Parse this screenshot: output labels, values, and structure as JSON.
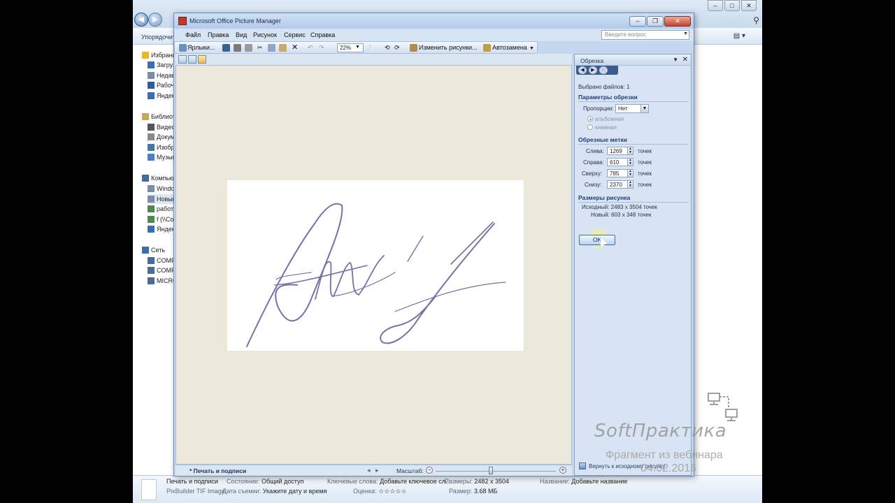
{
  "explorer": {
    "organize_label": "Упорядочить",
    "nav_items": [
      {
        "label": "Избранное",
        "icon": "star-icon"
      },
      {
        "label": "Загрузки",
        "icon": "downloads-icon"
      },
      {
        "label": "Недавние места",
        "icon": "recent-places-icon"
      },
      {
        "label": "Рабочий стол",
        "icon": "desktop-icon"
      },
      {
        "label": "Яндекс.Диск",
        "icon": "cloud-icon"
      },
      {
        "label": "Библиотеки",
        "icon": "library-icon"
      },
      {
        "label": "Видео",
        "icon": "video-icon"
      },
      {
        "label": "Документы",
        "icon": "documents-icon"
      },
      {
        "label": "Изображения",
        "icon": "pictures-icon"
      },
      {
        "label": "Музыка",
        "icon": "music-icon"
      },
      {
        "label": "Компьютер",
        "icon": "computer-icon"
      },
      {
        "label": "Windows",
        "icon": "drive-icon"
      },
      {
        "label": "Новый том",
        "icon": "drive-icon"
      },
      {
        "label": "работа",
        "icon": "network-drive-icon"
      },
      {
        "label": "f (\\\\Co",
        "icon": "network-drive-icon"
      },
      {
        "label": "Яндекс",
        "icon": "cloud-icon"
      },
      {
        "label": "Сеть",
        "icon": "network-icon"
      },
      {
        "label": "COMP",
        "icon": "computer-icon"
      },
      {
        "label": "COMP",
        "icon": "computer-icon"
      },
      {
        "label": "MICRO",
        "icon": "computer-icon"
      }
    ],
    "details": {
      "file_name": "Печать и подписи",
      "file_type": "PixBuilder TIF Image",
      "state_label": "Состояние:",
      "state_value": "Общий доступ",
      "date_label": "Дата съемки:",
      "date_value": "Укажите дату и время",
      "keywords_label": "Ключевые слова:",
      "keywords_value": "Добавьте ключевое сл...",
      "rating_label": "Оценка:",
      "rating_value": "☆☆☆☆☆",
      "dimensions_label": "Размеры:",
      "dimensions_value": "2482 x 3504",
      "size_label": "Размер:",
      "size_value": "3.68 МБ",
      "title_label": "Название:",
      "title_value": "Добавьте название"
    }
  },
  "picture_manager": {
    "title": "Microsoft Office Picture Manager",
    "menu": [
      "Файл",
      "Правка",
      "Вид",
      "Рисунок",
      "Сервис",
      "Справка"
    ],
    "ask_placeholder": "Введите вопрос",
    "toolbar": {
      "shortcuts_label": "Ярлыки...",
      "zoom_value": "22%",
      "edit_pictures_label": "Изменить рисунки...",
      "autocorrect_label": "Автозамена"
    },
    "status": {
      "file_name": "* Печать и подписи",
      "zoom_label": "Масштаб:"
    },
    "zoom_level_fraction": 0.46
  },
  "crop_pane": {
    "title": "Обрезка",
    "selected_files": "Выбрано файлов: 1",
    "crop_params_heading": "Параметры обрезки",
    "proportion_label": "Пропорции:",
    "proportion_value": "Нет",
    "landscape_label": "альбомная",
    "portrait_label": "книжная",
    "crop_marks_heading": "Обрезные метки",
    "unit": "точек",
    "left_label": "Слева:",
    "left_value": "1269",
    "right_label": "Справа:",
    "right_value": "610",
    "top_label": "Сверху:",
    "top_value": "785",
    "bottom_label": "Снизу:",
    "bottom_value": "2370",
    "sizes_heading": "Размеры рисунка",
    "original_size": "Исходный:   2483 x 3504 точек",
    "new_size": "Новый:   603 x 348 точек",
    "ok_label": "OK",
    "reset_label": "Вернуть к исходному рисунку"
  },
  "watermark": {
    "brand": "SoftПрактика",
    "subtitle": "Фрагмент из вебинара",
    "date": "04.02.2016"
  },
  "colors": {
    "pane_bg": "#d8e4f3",
    "canvas_bg": "#ebe8d9",
    "heading_blue": "#1e3f74",
    "signature_ink": "#5b5a9a"
  }
}
